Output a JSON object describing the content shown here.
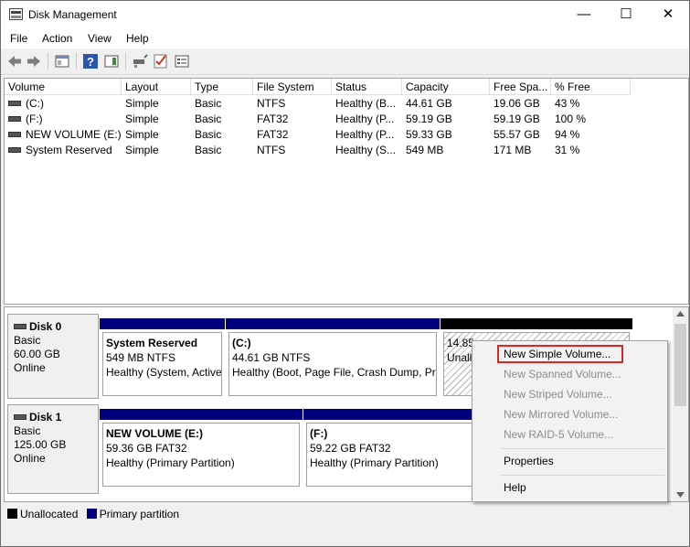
{
  "window": {
    "title": "Disk Management",
    "controls": [
      "—",
      "☐",
      "✕"
    ]
  },
  "menu": [
    "File",
    "Action",
    "View",
    "Help"
  ],
  "volume_list": {
    "columns": [
      "Volume",
      "Layout",
      "Type",
      "File System",
      "Status",
      "Capacity",
      "Free Spa...",
      "% Free"
    ],
    "rows": [
      [
        "(C:)",
        "Simple",
        "Basic",
        "NTFS",
        "Healthy (B...",
        "44.61 GB",
        "19.06 GB",
        "43 %"
      ],
      [
        "(F:)",
        "Simple",
        "Basic",
        "FAT32",
        "Healthy (P...",
        "59.19 GB",
        "59.19 GB",
        "100 %"
      ],
      [
        "NEW VOLUME (E:)",
        "Simple",
        "Basic",
        "FAT32",
        "Healthy (P...",
        "59.33 GB",
        "55.57 GB",
        "94 %"
      ],
      [
        "System Reserved",
        "Simple",
        "Basic",
        "NTFS",
        "Healthy (S...",
        "549 MB",
        "171 MB",
        "31 %"
      ]
    ]
  },
  "disks": [
    {
      "name": "Disk 0",
      "type": "Basic",
      "size": "60.00 GB",
      "state": "Online",
      "partitions": [
        {
          "title": "System Reserved",
          "detail": "549 MB NTFS",
          "status": "Healthy (System, Active"
        },
        {
          "title": "(C:)",
          "detail": "44.61 GB NTFS",
          "status": "Healthy (Boot, Page File, Crash Dump, Pri"
        },
        {
          "title": "",
          "detail": "14.85",
          "status": "Unall"
        }
      ]
    },
    {
      "name": "Disk 1",
      "type": "Basic",
      "size": "125.00 GB",
      "state": "Online",
      "partitions": [
        {
          "title": "NEW VOLUME  (E:)",
          "detail": "59.36 GB FAT32",
          "status": "Healthy (Primary Partition)"
        },
        {
          "title": "(F:)",
          "detail": "59.22 GB FAT32",
          "status": "Healthy (Primary Partition)"
        }
      ]
    }
  ],
  "legend": [
    "Unallocated",
    "Primary partition"
  ],
  "context_menu": {
    "items": [
      {
        "label": "New Simple Volume...",
        "enabled": true
      },
      {
        "label": "New Spanned Volume...",
        "enabled": false
      },
      {
        "label": "New Striped Volume...",
        "enabled": false
      },
      {
        "label": "New Mirrored Volume...",
        "enabled": false
      },
      {
        "label": "New RAID-5 Volume...",
        "enabled": false
      },
      {
        "label": "Properties",
        "enabled": true
      },
      {
        "label": "Help",
        "enabled": true
      }
    ]
  },
  "colors": {
    "primary": "#00007f",
    "unallocated": "#000000",
    "highlight": "#e0261e"
  }
}
